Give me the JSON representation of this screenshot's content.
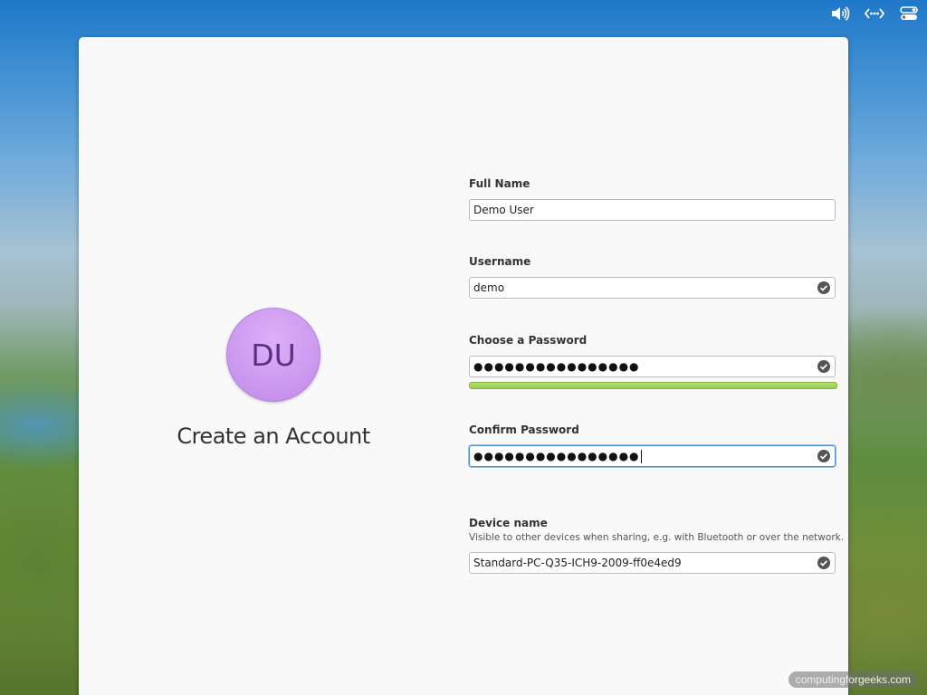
{
  "topbar": {
    "icons": [
      "volume-icon",
      "network-icon",
      "system-menu-icon"
    ]
  },
  "account": {
    "avatar_initials": "DU",
    "title": "Create an Account"
  },
  "form": {
    "full_name_label": "Full Name",
    "full_name_value": "Demo User",
    "username_label": "Username",
    "username_value": "demo",
    "password_label": "Choose a Password",
    "password_mask": "●●●●●●●●●●●●●●●●",
    "password_strength": 1.0,
    "confirm_label": "Confirm Password",
    "confirm_mask": "●●●●●●●●●●●●●●●●",
    "device_label": "Device name",
    "device_hint": "Visible to other devices when sharing, e.g. with Bluetooth or over the network.",
    "device_value": "Standard-PC-Q35-ICH9-2009-ff0e4ed9"
  },
  "watermark": "computingforgeeks.com",
  "colors": {
    "avatar": "#c792ee",
    "strength": "#9bcc52",
    "focus": "#4a90d9"
  }
}
